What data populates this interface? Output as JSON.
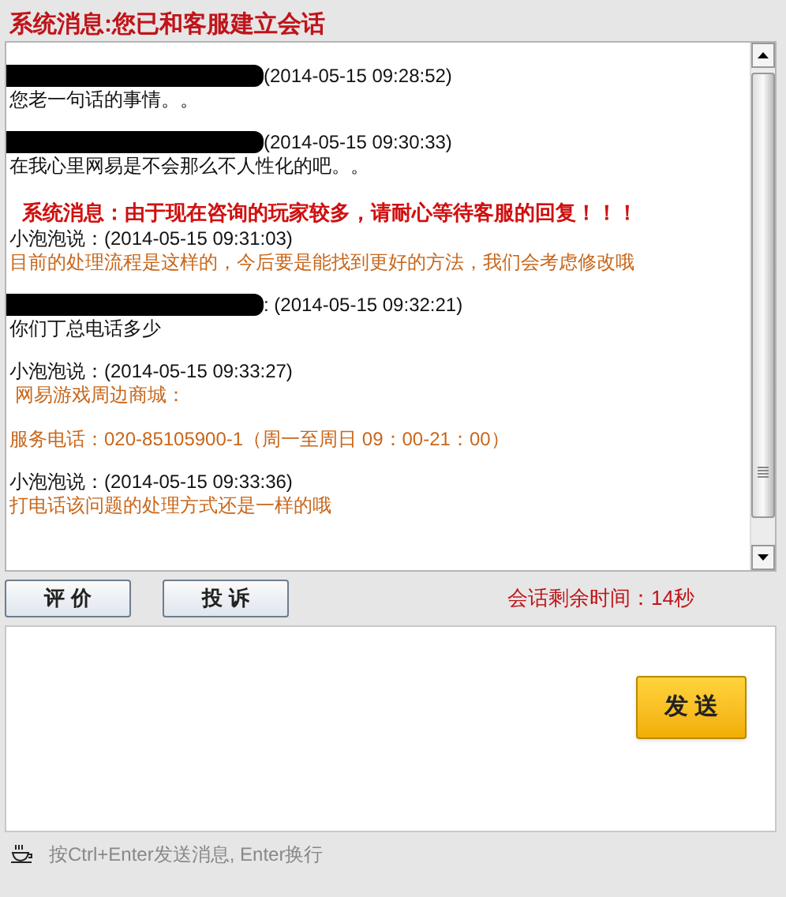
{
  "header": {
    "title": "系统消息:您已和客服建立会话"
  },
  "messages": [
    {
      "kind": "user",
      "time": "(2014-05-15 09:28:52)",
      "lines": [
        "您老一句话的事情。。"
      ]
    },
    {
      "kind": "user",
      "time": "(2014-05-15 09:30:33)",
      "lines": [
        "在我心里网易是不会那么不人性化的吧。。"
      ]
    },
    {
      "kind": "system",
      "text": "系统消息：由于现在咨询的玩家较多，请耐心等待客服的回复！！！"
    },
    {
      "kind": "agent",
      "sender": "小泡泡说：",
      "time": "(2014-05-15 09:31:03)",
      "lines": [
        "目前的处理流程是这样的，今后要是能找到更好的方法，我们会考虑修改哦"
      ]
    },
    {
      "kind": "user",
      "time": ": (2014-05-15 09:32:21)",
      "lines": [
        "你们丁总电话多少"
      ]
    },
    {
      "kind": "agent",
      "sender": "小泡泡说：",
      "time": "(2014-05-15 09:33:27)",
      "lines": [
        " 网易游戏周边商城：",
        "服务电话：020-85105900-1（周一至周日 09：00-21：00）"
      ]
    },
    {
      "kind": "agent",
      "sender": "小泡泡说：",
      "time": "(2014-05-15 09:33:36)",
      "lines": [
        "打电话该问题的处理方式还是一样的哦"
      ]
    }
  ],
  "actions": [
    "评 价",
    "投 诉"
  ],
  "session_timer": "会话剩余时间：14秒",
  "send_button": "发 送",
  "hint": "按Ctrl+Enter发送消息, Enter换行"
}
